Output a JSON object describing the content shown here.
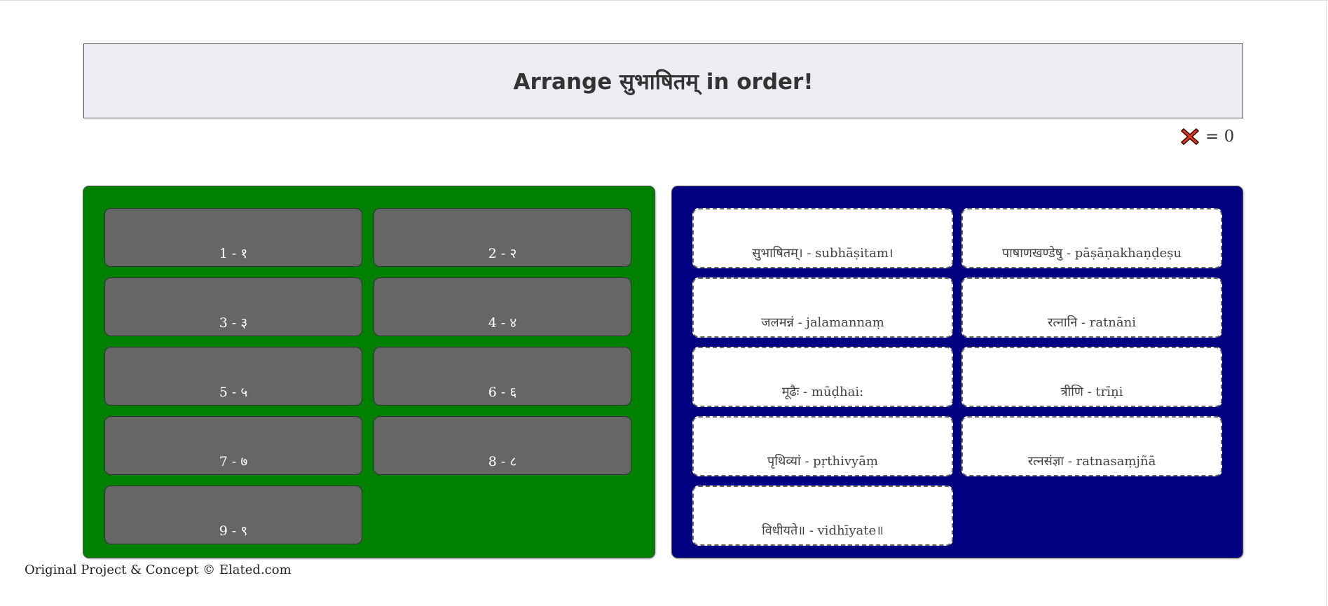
{
  "header": {
    "title": "Arrange सुभाषितम् in order!"
  },
  "score": {
    "icon": "red-x-icon",
    "text": "= 0"
  },
  "slots": [
    {
      "label": "1 - १"
    },
    {
      "label": "2 - २"
    },
    {
      "label": "3 - ३"
    },
    {
      "label": "4 - ४"
    },
    {
      "label": "5 - ५"
    },
    {
      "label": "6 - ६"
    },
    {
      "label": "7 - ७"
    },
    {
      "label": "8 - ८"
    },
    {
      "label": "9 - ९"
    }
  ],
  "cards": [
    {
      "label": "सुभाषितम्। - subhāṣitam।"
    },
    {
      "label": "पाषाणखण्डेषु - pāṣāṇakhaṇḍeṣu"
    },
    {
      "label": "जलमन्नं - jalamannaṃ"
    },
    {
      "label": "रत्नानि - ratnāni"
    },
    {
      "label": "मूढैः - mūḍhai:"
    },
    {
      "label": "त्रीणि - trīṇi"
    },
    {
      "label": "पृथिव्यां - pṛthivyāṃ"
    },
    {
      "label": "रत्नसंज्ञा - ratnasaṃjñā"
    },
    {
      "label": "विधीयते॥ - vidhīyate॥"
    }
  ],
  "footer": {
    "text": "Original Project & Concept © Elated.com"
  },
  "colors": {
    "correct_panel": "#008000",
    "cards_panel": "#000080",
    "slot": "#666666"
  }
}
